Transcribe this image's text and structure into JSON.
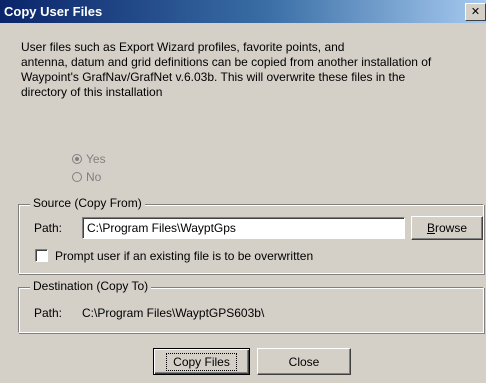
{
  "window": {
    "title": "Copy User Files",
    "close_glyph": "✕"
  },
  "description": "User files such as Export Wizard profiles, favorite points, and\nantenna, datum and grid definitions can be copied from another installation of\nWaypoint's GrafNav/GrafNet v.6.03b.  This will overwrite these files in the\ndirectory of this installation",
  "radio": {
    "yes_label": "Yes",
    "no_label": "No",
    "selected": "Yes",
    "enabled": false
  },
  "source": {
    "group_label": "Source (Copy From)",
    "path_label": "Path:",
    "path_value": "C:\\Program Files\\WayptGps",
    "browse_first": "B",
    "browse_rest": "rowse",
    "prompt_label": "Prompt user if an existing file is to be overwritten",
    "prompt_checked": false
  },
  "destination": {
    "group_label": "Destination (Copy To)",
    "path_label": "Path:",
    "path_value": "C:\\Program Files\\WayptGPS603b\\"
  },
  "buttons": {
    "copy_files": "Copy Files",
    "close": "Close"
  }
}
